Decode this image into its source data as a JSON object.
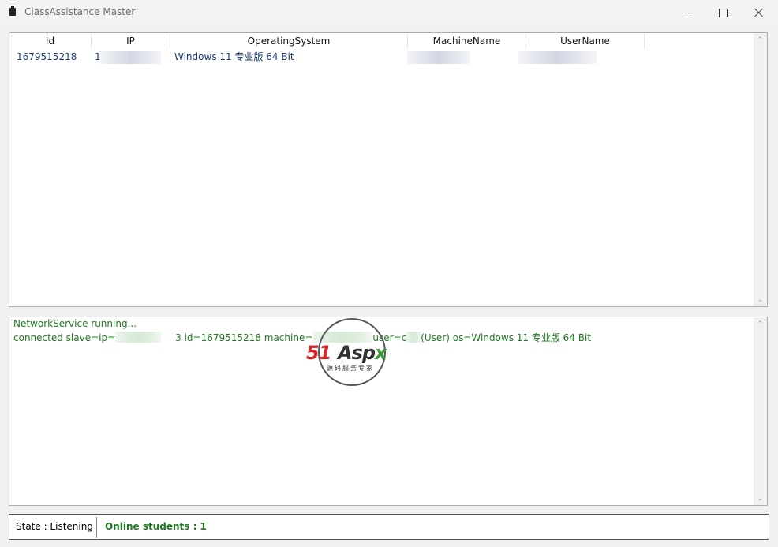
{
  "window": {
    "title": "ClassAssistance Master",
    "controls": {
      "minimize": "minimize",
      "maximize": "maximize",
      "close": "close"
    }
  },
  "clients_table": {
    "columns": [
      "Id",
      "IP",
      "OperatingSystem",
      "MachineName",
      "UserName"
    ],
    "rows": [
      {
        "id": "1679515218",
        "ip": "1",
        "os": "Windows 11 专业版 64 Bit",
        "machine": "",
        "user": ""
      }
    ]
  },
  "log": {
    "lines": [
      "NetworkService running...",
      {
        "p1": "connected slave=ip=",
        "p2": "3 id=1679515218 machine=",
        "p3": "user=c",
        "p4": "(User) os=Windows 11 专业版 64 Bit"
      }
    ]
  },
  "watermark": {
    "brand_red": "51",
    "brand_dark": "Asp",
    "brand_green": "x",
    "tagline": "源码服务专家"
  },
  "status": {
    "state": "State : Listening",
    "online": "Online students : 1"
  },
  "colors": {
    "log_text": "#1e7a1e",
    "row_text": "#1a3a7a",
    "brand_red": "#d9262a",
    "brand_green": "#3a9a3a"
  }
}
